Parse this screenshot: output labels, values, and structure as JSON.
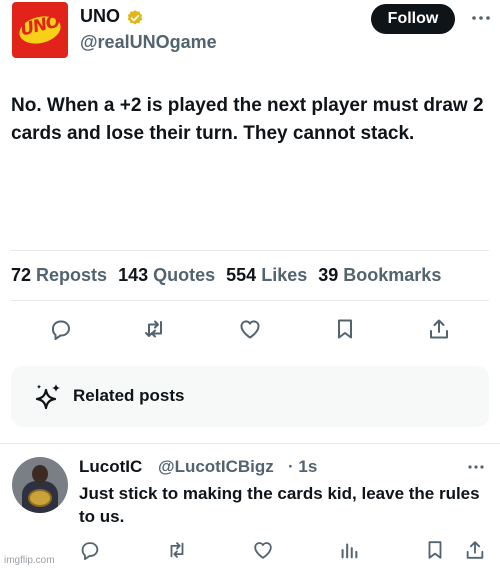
{
  "tweet": {
    "author_name": "UNO",
    "author_handle": "@realUNOgame",
    "logo_text": "UNO",
    "follow_label": "Follow",
    "text": "No. When a +2 is played the next player must draw 2 cards and lose their turn. They cannot stack.",
    "stats": [
      {
        "num": "72",
        "label": "Reposts"
      },
      {
        "num": "143",
        "label": "Quotes"
      },
      {
        "num": "554",
        "label": "Likes"
      },
      {
        "num": "39",
        "label": "Bookmarks"
      }
    ],
    "actions": [
      "reply-icon",
      "repost-icon",
      "like-icon",
      "bookmark-icon",
      "share-icon"
    ]
  },
  "related": {
    "label": "Related posts",
    "icon": "sparkle-icon"
  },
  "reply": {
    "author_name": "LucotIC",
    "author_handle": "@LucotICBigz",
    "time": "· 1s",
    "text": "Just stick to making the cards kid, leave the rules to us.",
    "actions": [
      "reply-icon",
      "repost-icon",
      "like-icon",
      "views-icon",
      "bookmark-icon",
      "share-icon"
    ]
  },
  "watermark": "imgflip.com",
  "colors": {
    "text_primary": "#0f1419",
    "text_secondary": "#536471",
    "uno_red": "#e2231a",
    "uno_yellow": "#f7d117",
    "verified_gold": "#e2b719",
    "divider": "#e6e9eb",
    "related_bg": "#f7f9f9"
  }
}
